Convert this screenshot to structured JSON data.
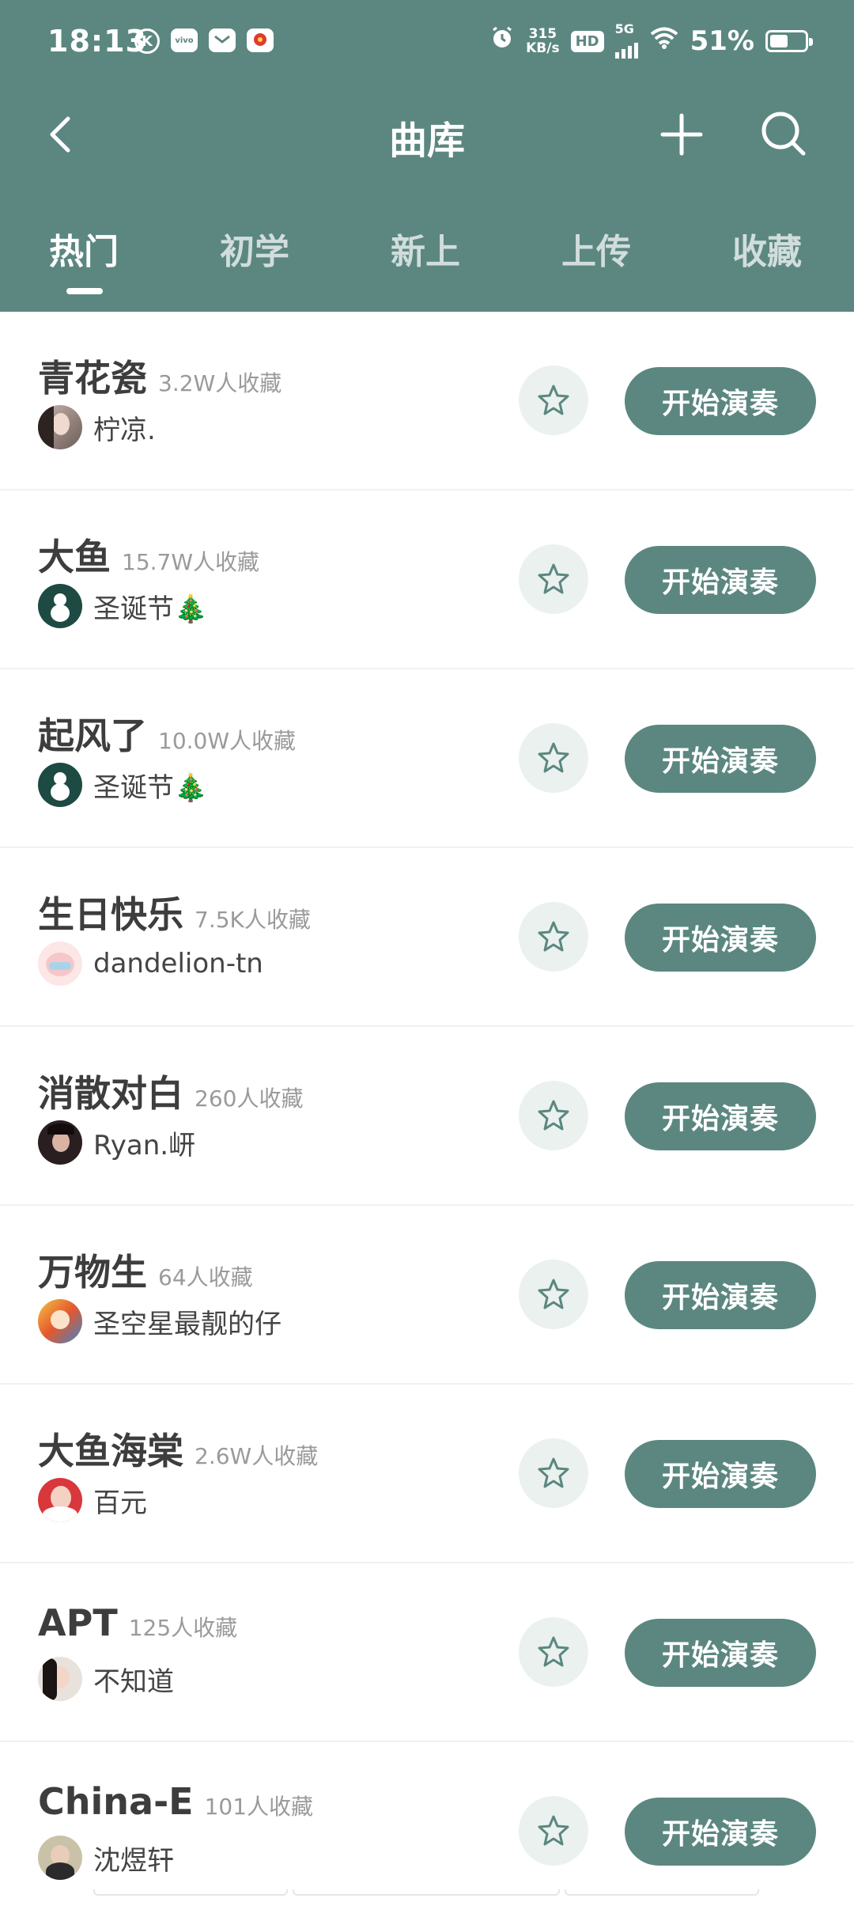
{
  "status_bar": {
    "time": "18:13",
    "net_speed_value": "315",
    "net_speed_unit": "KB/s",
    "hd_badge": "HD",
    "signal_label": "5G",
    "battery_text": "51%",
    "icons": [
      "k-circle-icon",
      "vivo-app-icon",
      "mail-app-icon",
      "red-app-icon",
      "alarm-icon",
      "wifi-icon",
      "battery-icon"
    ]
  },
  "header": {
    "title": "曲库",
    "back_icon": "chevron-left-icon",
    "add_icon": "plus-icon",
    "search_icon": "search-icon",
    "accent_color": "#5b8780"
  },
  "tabs": [
    {
      "label": "热门",
      "active": true
    },
    {
      "label": "初学",
      "active": false
    },
    {
      "label": "新上",
      "active": false
    },
    {
      "label": "上传",
      "active": false
    },
    {
      "label": "收藏",
      "active": false
    }
  ],
  "songs": [
    {
      "title": "青花瓷",
      "favorites": "3.2W人收藏",
      "author": "柠凉.",
      "play_label": "开始演奏"
    },
    {
      "title": "大鱼",
      "favorites": "15.7W人收藏",
      "author": "圣诞节🎄",
      "play_label": "开始演奏"
    },
    {
      "title": "起风了",
      "favorites": "10.0W人收藏",
      "author": "圣诞节🎄",
      "play_label": "开始演奏"
    },
    {
      "title": "生日快乐",
      "favorites": "7.5K人收藏",
      "author": "dandelion-tn",
      "play_label": "开始演奏"
    },
    {
      "title": "消散对白",
      "favorites": "260人收藏",
      "author": "Ryan.岍",
      "play_label": "开始演奏"
    },
    {
      "title": "万物生",
      "favorites": "64人收藏",
      "author": "圣空星最靓的仔",
      "play_label": "开始演奏"
    },
    {
      "title": "大鱼海棠",
      "favorites": "2.6W人收藏",
      "author": "百元",
      "play_label": "开始演奏"
    },
    {
      "title": "APT",
      "favorites": "125人收藏",
      "author": "不知道",
      "play_label": "开始演奏"
    },
    {
      "title": "China-E",
      "favorites": "101人收藏",
      "author": "沈煜轩",
      "play_label": "开始演奏"
    }
  ]
}
